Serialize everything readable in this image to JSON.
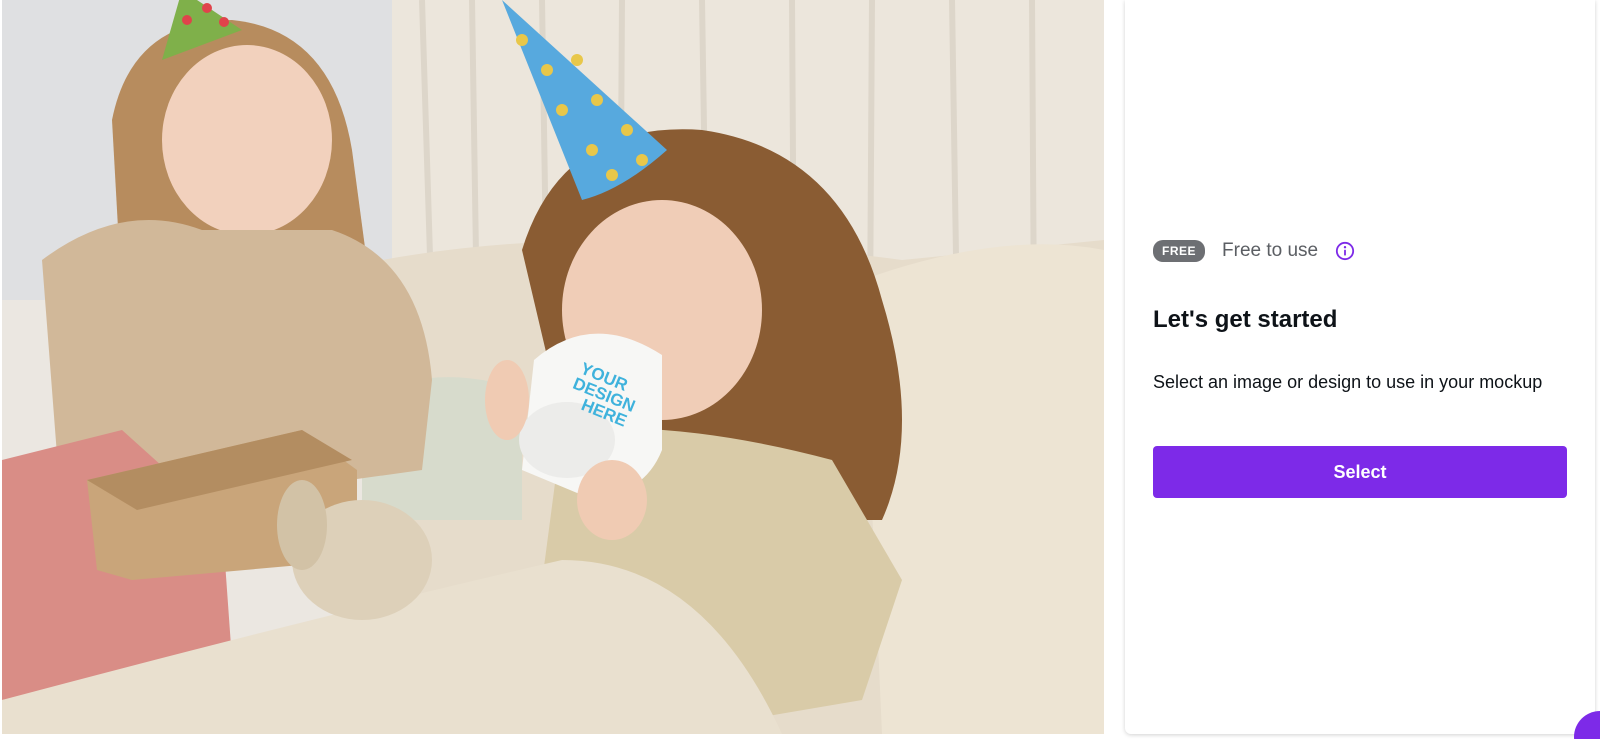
{
  "preview": {
    "mug_print_text": "YOUR DESIGN HERE"
  },
  "license": {
    "badge": "FREE",
    "label": "Free to use",
    "icon": "info-icon"
  },
  "panel": {
    "heading": "Let's get started",
    "description": "Select an image or design to use in your mockup",
    "select_label": "Select"
  },
  "colors": {
    "accent": "#7d2ae8",
    "badge_bg": "#6d6f73",
    "text": "#0e1318",
    "muted_text": "#5b5e63"
  }
}
